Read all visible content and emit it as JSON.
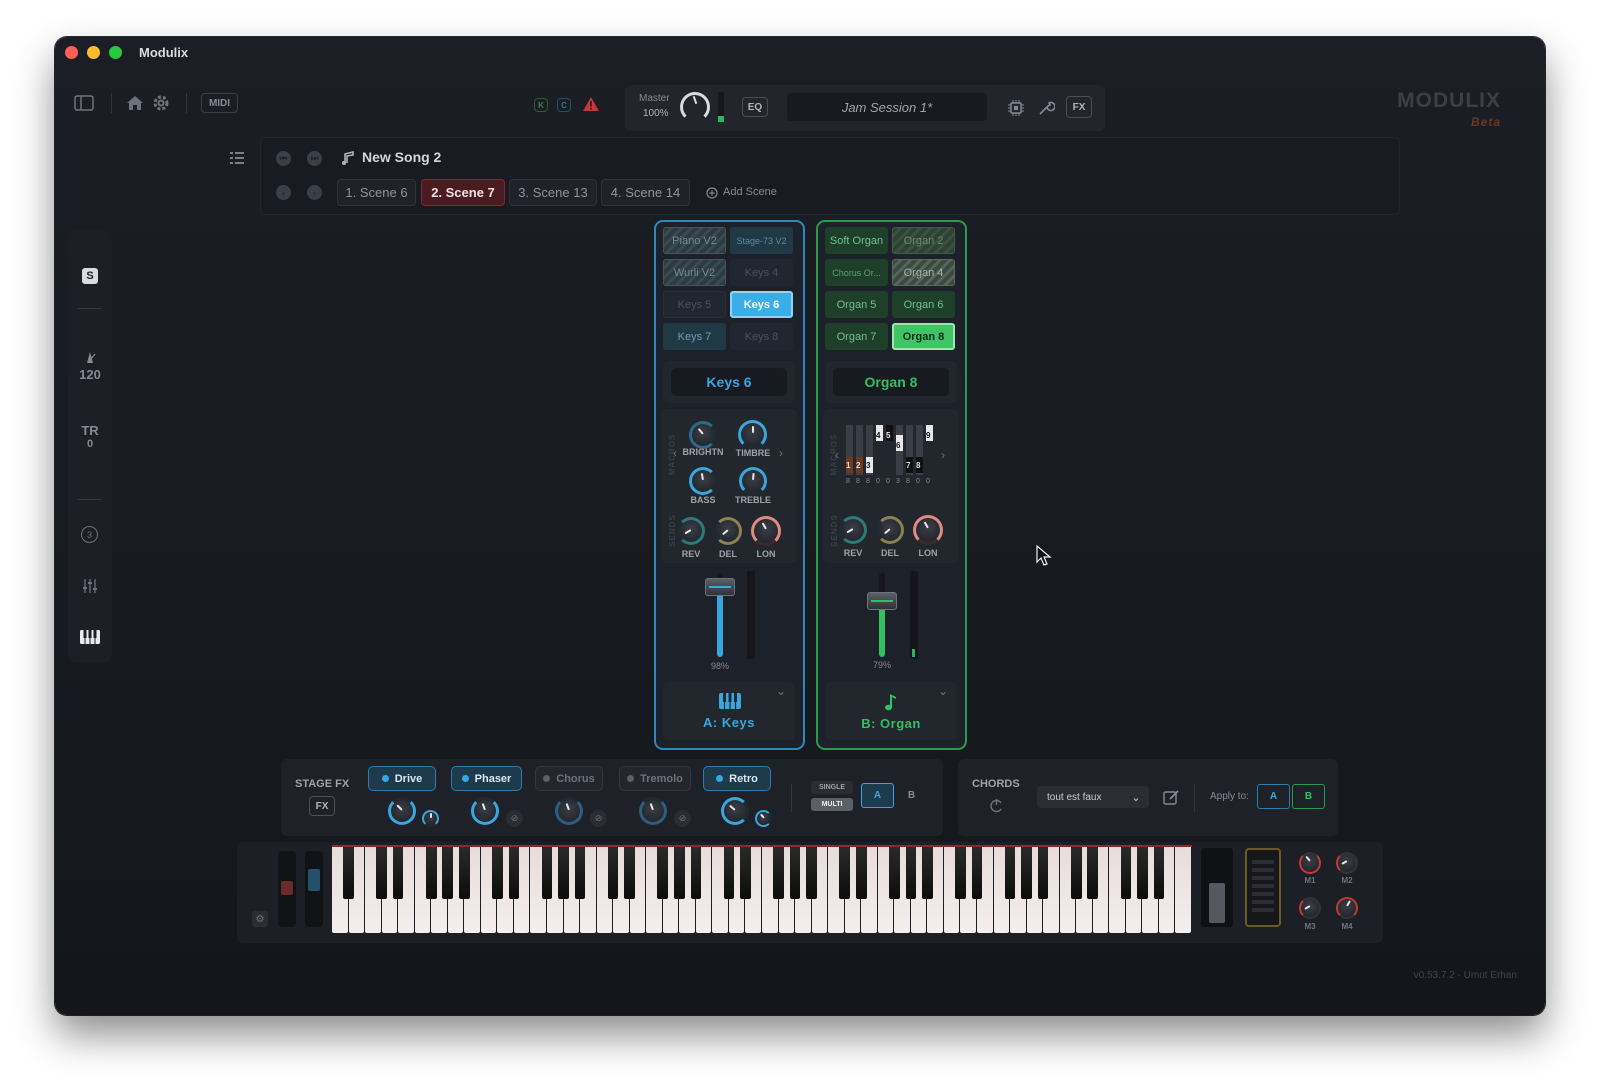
{
  "window": {
    "title": "Modulix"
  },
  "toolbar": {
    "midi_label": "MIDI",
    "indicator_k": "K",
    "indicator_c": "C",
    "master_label": "Master",
    "master_value": "100%",
    "eq_label": "EQ",
    "session_name": "Jam Session 1*",
    "fx_label": "FX",
    "logo": "MODULIX",
    "logo_sub": "Beta"
  },
  "song": {
    "title": "New Song 2",
    "scenes": [
      "1. Scene 6",
      "2. Scene 7",
      "3. Scene 13",
      "4. Scene 14"
    ],
    "active_scene": 1,
    "add_scene": "Add Scene"
  },
  "sidebar": {
    "s_label": "S",
    "tempo": "120",
    "tr_label": "TR",
    "tr_value": "0",
    "count": "3"
  },
  "channel_a": {
    "slots": [
      "Piano V2",
      "Stage-73 V2",
      "Wurli V2",
      "Keys 4",
      "Keys 5",
      "Keys 6",
      "Keys 7",
      "Keys 8"
    ],
    "selected": "Keys 6",
    "macros_label": "MACROS",
    "macros": [
      "BRIGHTN",
      "TIMBRE",
      "BASS",
      "TREBLE"
    ],
    "sends_label": "SENDS",
    "sends": [
      "REV",
      "DEL",
      "LON"
    ],
    "fader_value": "98%",
    "fader_level": 0.98,
    "instrument": "A: Keys",
    "color": "#3aa6de"
  },
  "channel_b": {
    "slots": [
      "Soft Organ",
      "Organ 2",
      "Chorus Or...",
      "Organ 4",
      "Organ 5",
      "Organ 6",
      "Organ 7",
      "Organ 8"
    ],
    "selected": "Organ 8",
    "macros_label": "MACROS",
    "drawbar_top": [
      "4",
      "5",
      "6",
      "9"
    ],
    "drawbar_bottom": [
      "1",
      "2",
      "3",
      "7",
      "8"
    ],
    "drawbar_values": [
      "8",
      "8",
      "8",
      "0",
      "0",
      "3",
      "8",
      "0",
      "0"
    ],
    "sends_label": "SENDS",
    "sends": [
      "REV",
      "DEL",
      "LON"
    ],
    "fader_value": "79%",
    "fader_level": 0.79,
    "instrument": "B: Organ",
    "color": "#33c060"
  },
  "stage_fx": {
    "title": "STAGE FX",
    "fx_button": "FX",
    "effects": [
      {
        "name": "Drive",
        "on": true
      },
      {
        "name": "Phaser",
        "on": true
      },
      {
        "name": "Chorus",
        "on": false
      },
      {
        "name": "Tremolo",
        "on": false
      },
      {
        "name": "Retro",
        "on": true
      }
    ],
    "single": "SINGLE",
    "multi": "MULTI",
    "a": "A",
    "b": "B"
  },
  "chords": {
    "title": "CHORDS",
    "preset": "tout est faux",
    "apply_to": "Apply to:",
    "a": "A",
    "b": "B"
  },
  "keyboard": {
    "macros": [
      "M1",
      "M2",
      "M3",
      "M4"
    ]
  },
  "footer": {
    "version": "v0.53.7.2 - Umut Erhan"
  }
}
